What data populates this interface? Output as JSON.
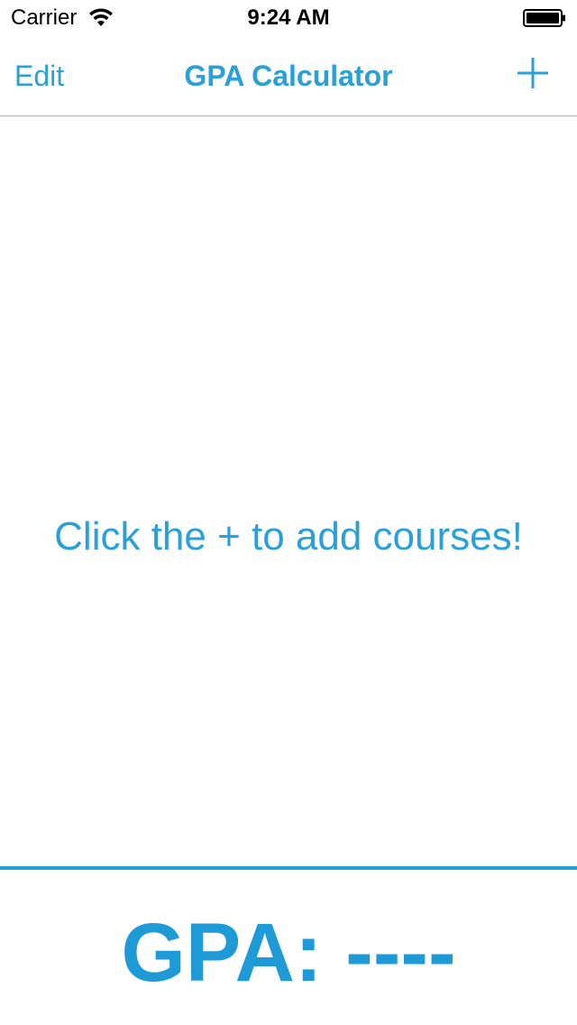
{
  "status_bar": {
    "carrier": "Carrier",
    "time": "9:24 AM",
    "wifi_icon": "wifi-icon",
    "battery_icon": "battery-icon"
  },
  "nav": {
    "edit_label": "Edit",
    "title": "GPA Calculator",
    "add_icon": "plus-icon"
  },
  "main": {
    "empty_message": "Click the + to add courses!"
  },
  "footer": {
    "gpa_text": "GPA: ----"
  },
  "colors": {
    "accent": "#2a9fd8",
    "gpa": "#1e9ad6",
    "separator": "#b2b2b2"
  }
}
